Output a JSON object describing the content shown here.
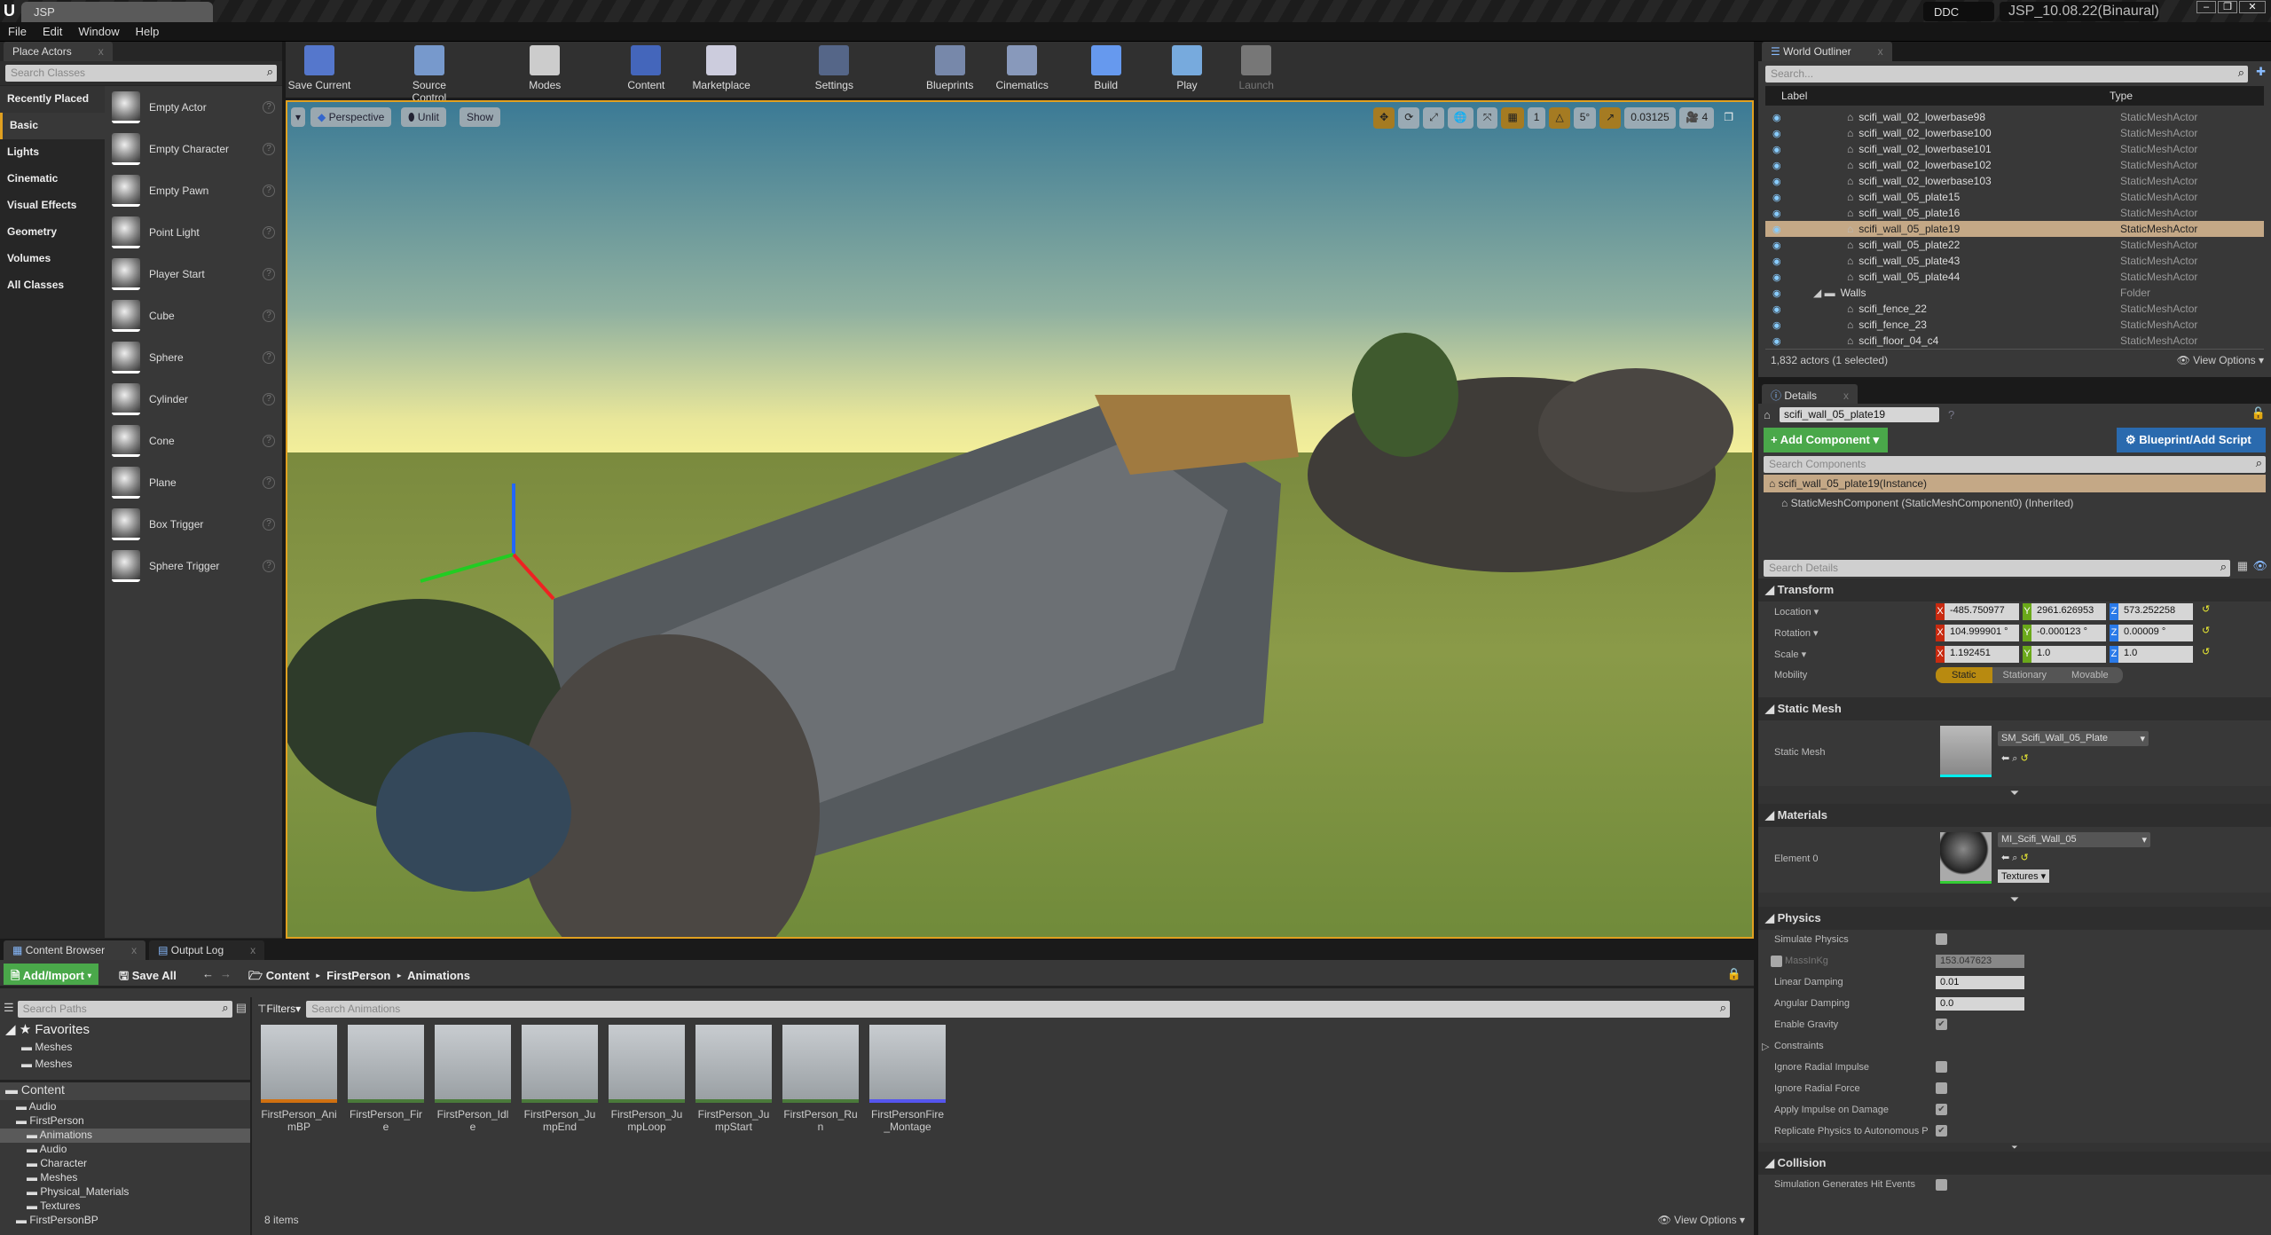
{
  "title_bar": {
    "doc_tab": "JSP",
    "ddc": "DDC",
    "project": "JSP_10.08.22(Binaural)"
  },
  "menu": [
    "File",
    "Edit",
    "Window",
    "Help"
  ],
  "place_actors": {
    "tab": "Place Actors",
    "search_placeholder": "Search Classes",
    "categories": [
      "Recently Placed",
      "Basic",
      "Lights",
      "Cinematic",
      "Visual Effects",
      "Geometry",
      "Volumes",
      "All Classes"
    ],
    "selected_category": "Basic",
    "items": [
      "Empty Actor",
      "Empty Character",
      "Empty Pawn",
      "Point Light",
      "Player Start",
      "Cube",
      "Sphere",
      "Cylinder",
      "Cone",
      "Plane",
      "Box Trigger",
      "Sphere Trigger"
    ]
  },
  "toolbar": [
    "Save Current",
    "Source Control",
    "Modes",
    "Content",
    "Marketplace",
    "Settings",
    "Blueprints",
    "Cinematics",
    "Build",
    "Play",
    "Launch"
  ],
  "viewport": {
    "buttons": [
      "Perspective",
      "Unlit",
      "Show"
    ],
    "grid": "1",
    "rotation_snap": "5°",
    "scale_snap": "0.03125",
    "camera_speed": "4"
  },
  "outliner": {
    "tab": "World Outliner",
    "search_placeholder": "Search...",
    "col_label": "Label",
    "col_type": "Type",
    "rows": [
      {
        "name": "scifi_wall_02_lowerbase98",
        "type": "StaticMeshActor"
      },
      {
        "name": "scifi_wall_02_lowerbase100",
        "type": "StaticMeshActor"
      },
      {
        "name": "scifi_wall_02_lowerbase101",
        "type": "StaticMeshActor"
      },
      {
        "name": "scifi_wall_02_lowerbase102",
        "type": "StaticMeshActor"
      },
      {
        "name": "scifi_wall_02_lowerbase103",
        "type": "StaticMeshActor"
      },
      {
        "name": "scifi_wall_05_plate15",
        "type": "StaticMeshActor"
      },
      {
        "name": "scifi_wall_05_plate16",
        "type": "StaticMeshActor"
      },
      {
        "name": "scifi_wall_05_plate19",
        "type": "StaticMeshActor",
        "selected": true
      },
      {
        "name": "scifi_wall_05_plate22",
        "type": "StaticMeshActor"
      },
      {
        "name": "scifi_wall_05_plate43",
        "type": "StaticMeshActor"
      },
      {
        "name": "scifi_wall_05_plate44",
        "type": "StaticMeshActor"
      },
      {
        "name": "Walls",
        "type": "Folder",
        "folder": true
      },
      {
        "name": "scifi_fence_22",
        "type": "StaticMeshActor"
      },
      {
        "name": "scifi_fence_23",
        "type": "StaticMeshActor"
      },
      {
        "name": "scifi_floor_04_c4",
        "type": "StaticMeshActor"
      }
    ],
    "status": "1,832 actors (1 selected)",
    "view_options": "View Options"
  },
  "details": {
    "tab": "Details",
    "actor_name": "scifi_wall_05_plate19",
    "add_component": "+ Add Component",
    "blueprint": "Blueprint/Add Script",
    "search_components": "Search Components",
    "instance": "scifi_wall_05_plate19(Instance)",
    "component": "StaticMeshComponent (StaticMeshComponent0) (Inherited)",
    "search_details": "Search Details",
    "transform": {
      "header": "Transform",
      "location_label": "Location",
      "rotation_label": "Rotation",
      "scale_label": "Scale",
      "mobility_label": "Mobility",
      "location": [
        "-485.750977",
        "2961.626953",
        "573.252258"
      ],
      "rotation": [
        "104.999901 °",
        "-0.000123 °",
        "0.00009 °"
      ],
      "scale": [
        "1.192451",
        "1.0",
        "1.0"
      ],
      "mobility": [
        "Static",
        "Stationary",
        "Movable"
      ]
    },
    "static_mesh": {
      "header": "Static Mesh",
      "label": "Static Mesh",
      "value": "SM_Scifi_Wall_05_Plate"
    },
    "materials": {
      "header": "Materials",
      "label": "Element 0",
      "value": "MI_Scifi_Wall_05",
      "textures": "Textures"
    },
    "physics": {
      "header": "Physics",
      "simulate": "Simulate Physics",
      "mass_label": "MassInKg",
      "mass": "153.047623",
      "linear_label": "Linear Damping",
      "linear": "0.01",
      "angular_label": "Angular Damping",
      "angular": "0.0",
      "gravity": "Enable Gravity",
      "constraints": "Constraints",
      "ignore_impulse": "Ignore Radial Impulse",
      "ignore_force": "Ignore Radial Force",
      "apply_impulse": "Apply Impulse on Damage",
      "replicate": "Replicate Physics to Autonomous P"
    },
    "collision": {
      "header": "Collision",
      "hit_events": "Simulation Generates Hit Events"
    }
  },
  "content_browser": {
    "tabs": [
      "Content Browser",
      "Output Log"
    ],
    "add_import": "Add/Import",
    "save_all": "Save All",
    "breadcrumb": [
      "Content",
      "FirstPerson",
      "Animations"
    ],
    "search_paths": "Search Paths",
    "filters": "Filters",
    "search_assets": "Search Animations",
    "favorites": "Favorites",
    "fav_folders": [
      "Meshes",
      "Meshes"
    ],
    "tree": [
      {
        "name": "Content",
        "d": 0
      },
      {
        "name": "Audio",
        "d": 1
      },
      {
        "name": "FirstPerson",
        "d": 1
      },
      {
        "name": "Animations",
        "d": 2,
        "sel": true
      },
      {
        "name": "Audio",
        "d": 2
      },
      {
        "name": "Character",
        "d": 2
      },
      {
        "name": "Meshes",
        "d": 2
      },
      {
        "name": "Physical_Materials",
        "d": 2
      },
      {
        "name": "Textures",
        "d": 2
      },
      {
        "name": "FirstPersonBP",
        "d": 1
      }
    ],
    "assets": [
      "FirstPerson_AnimBP",
      "FirstPerson_Fire",
      "FirstPerson_Idle",
      "FirstPerson_JumpEnd",
      "FirstPerson_JumpLoop",
      "FirstPerson_JumpStart",
      "FirstPerson_Run",
      "FirstPersonFire_Montage"
    ],
    "count": "8 items",
    "view_options": "View Options"
  }
}
